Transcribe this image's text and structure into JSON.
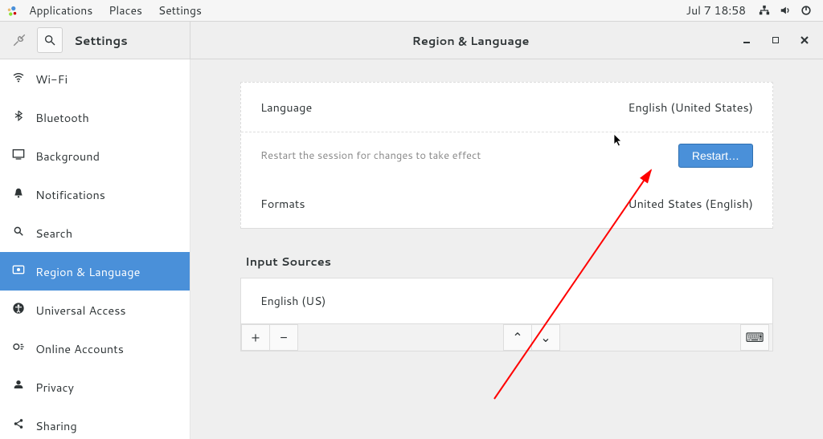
{
  "top_panel": {
    "menus": [
      "Applications",
      "Places",
      "Settings"
    ],
    "clock": "Jul 7  18:58"
  },
  "headerbar": {
    "settings_title": "Settings",
    "window_title": "Region & Language"
  },
  "sidebar": {
    "items": [
      {
        "icon": "wifi",
        "label": "Wi-Fi"
      },
      {
        "icon": "bluetooth",
        "label": "Bluetooth"
      },
      {
        "icon": "background",
        "label": "Background"
      },
      {
        "icon": "notifications",
        "label": "Notifications"
      },
      {
        "icon": "search",
        "label": "Search"
      },
      {
        "icon": "region",
        "label": "Region & Language"
      },
      {
        "icon": "universal",
        "label": "Universal Access"
      },
      {
        "icon": "online",
        "label": "Online Accounts"
      },
      {
        "icon": "privacy",
        "label": "Privacy"
      },
      {
        "icon": "sharing",
        "label": "Sharing"
      }
    ],
    "active_index": 5
  },
  "region": {
    "language_label": "Language",
    "language_value": "English (United States)",
    "restart_hint": "Restart the session for changes to take effect",
    "restart_button": "Restart…",
    "formats_label": "Formats",
    "formats_value": "United States (English)",
    "input_sources_title": "Input Sources",
    "sources": [
      "English (US)"
    ]
  },
  "toolbar_glyphs": {
    "plus": "+",
    "minus": "−",
    "up": "⌃",
    "down": "⌄",
    "keyboard": "⌨"
  }
}
